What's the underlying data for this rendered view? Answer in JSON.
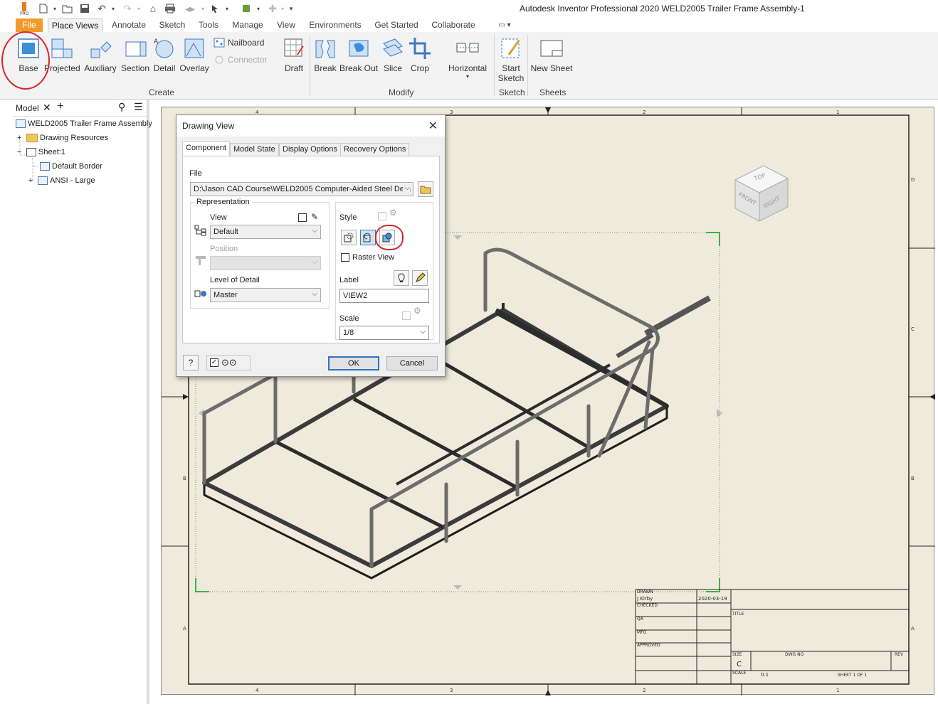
{
  "window": {
    "title": "Autodesk Inventor Professional 2020    WELD2005 Trailer Frame Assembly-1",
    "app_badge": "PRO"
  },
  "tabs": [
    {
      "label": "File"
    },
    {
      "label": "Place Views"
    },
    {
      "label": "Annotate"
    },
    {
      "label": "Sketch"
    },
    {
      "label": "Tools"
    },
    {
      "label": "Manage"
    },
    {
      "label": "View"
    },
    {
      "label": "Environments"
    },
    {
      "label": "Get Started"
    },
    {
      "label": "Collaborate"
    }
  ],
  "ribbon": {
    "create": {
      "label": "Create",
      "base": "Base",
      "projected": "Projected",
      "auxiliary": "Auxiliary",
      "section": "Section",
      "detail": "Detail",
      "overlay": "Overlay",
      "nailboard": "Nailboard",
      "connector": "Connector",
      "draft": "Draft"
    },
    "modify": {
      "label": "Modify",
      "break": "Break",
      "break_out": "Break Out",
      "slice": "Slice",
      "crop": "Crop",
      "horizontal": "Horizontal"
    },
    "sketch": {
      "label": "Sketch",
      "start_sketch_1": "Start",
      "start_sketch_2": "Sketch"
    },
    "sheets": {
      "label": "Sheets",
      "new_sheet": "New Sheet"
    }
  },
  "browser": {
    "tab_label": "Model",
    "tree": [
      {
        "label": "WELD2005 Trailer Frame Assembly"
      },
      {
        "label": "Drawing Resources"
      },
      {
        "label": "Sheet:1"
      },
      {
        "label": "Default Border"
      },
      {
        "label": "ANSI - Large"
      }
    ]
  },
  "sheet": {
    "zones_top": [
      "4",
      "3",
      "2",
      "1"
    ],
    "zones_bottom": [
      "4",
      "3",
      "2",
      "1"
    ],
    "zones_right": [
      "D",
      "C",
      "B",
      "A"
    ],
    "zones_left": [
      "B",
      "A"
    ],
    "viewcube": {
      "top": "TOP",
      "front": "FRONT",
      "right": "RIGHT"
    },
    "title_block": {
      "drawn_label": "DRAWN",
      "drawn_by": "J Kirby",
      "drawn_date": "2020-03-19",
      "checked_label": "CHECKED",
      "qa_label": "QA",
      "mfg_label": "MFG",
      "approved_label": "APPROVED",
      "title_label": "TITLE",
      "size_label": "SIZE",
      "size_value": "C",
      "dwg_no_label": "DWG NO",
      "rev_label": "REV",
      "scale_label": "SCALE",
      "scale_value": "0.1",
      "sheet_label": "SHEET 1  OF 1"
    }
  },
  "dialog": {
    "title": "Drawing View",
    "tabs": [
      "Component",
      "Model State",
      "Display Options",
      "Recovery Options"
    ],
    "file_label": "File",
    "file_value": "D:\\Jason CAD Course\\WELD2005 Computer-Aided Steel Deta",
    "representation_label": "Representation",
    "view_label": "View",
    "view_value": "Default",
    "position_label": "Position",
    "lod_label": "Level of Detail",
    "lod_value": "Master",
    "style_label": "Style",
    "raster_view_label": "Raster View",
    "label_label": "Label",
    "label_value": "VIEW2",
    "scale_label": "Scale",
    "scale_value": "1/8",
    "ok": "OK",
    "cancel": "Cancel"
  }
}
